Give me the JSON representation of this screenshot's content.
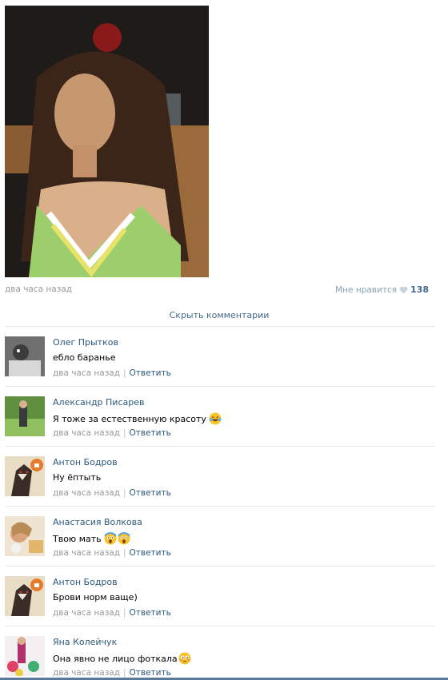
{
  "post": {
    "time": "два часа назад",
    "like_label": "Мне нравится",
    "like_count": "138",
    "like_icon": "heart-icon",
    "hide_comments": "Скрыть комментарии"
  },
  "comments": [
    {
      "author": "Олег Прытков",
      "text": "ебло баранье",
      "emoji": [],
      "time": "два часа назад",
      "reply": "Ответить"
    },
    {
      "author": "Александр Писарев",
      "text": "Я тоже за естественную красоту",
      "emoji": [
        "laughing-tears-emoji"
      ],
      "time": "два часа назад",
      "reply": "Ответить"
    },
    {
      "author": "Антон Бодров",
      "text": "Ну ёптыть",
      "emoji": [],
      "time": "два часа назад",
      "reply": "Ответить"
    },
    {
      "author": "Анастасия Волкова",
      "text": "Твою мать",
      "emoji": [
        "scream-emoji",
        "scream-emoji"
      ],
      "time": "два часа назад",
      "reply": "Ответить"
    },
    {
      "author": "Антон Бодров",
      "text": "Брови норм ваще)",
      "emoji": [],
      "time": "два часа назад",
      "reply": "Ответить"
    },
    {
      "author": "Яна Колейчук",
      "text": "Она явно не лицо фоткала",
      "emoji": [
        "flushed-emoji"
      ],
      "time": "два часа назад",
      "reply": "Ответить"
    }
  ],
  "colors": {
    "link": "#2b587a",
    "muted": "#999999",
    "like_count": "#45688e",
    "separator": "#e7ebef"
  }
}
